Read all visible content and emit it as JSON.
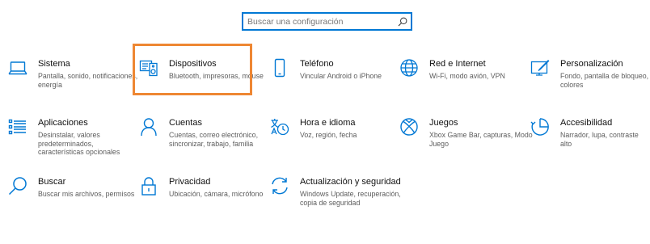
{
  "search": {
    "placeholder": "Buscar una configuración",
    "icon": "search-icon"
  },
  "accent_color": "#0078d4",
  "highlight_color": "#ee8733",
  "categories": [
    {
      "title": "Sistema",
      "desc": [
        "Pantalla, sonido, notificaciones,",
        "energía"
      ],
      "icon": "laptop-icon"
    },
    {
      "title": "Dispositivos",
      "desc": [
        "Bluetooth, impresoras, mouse"
      ],
      "icon": "devices-icon",
      "highlighted": true
    },
    {
      "title": "Teléfono",
      "desc": [
        "Vincular Android o iPhone"
      ],
      "icon": "phone-icon"
    },
    {
      "title": "Red e Internet",
      "desc": [
        "Wi-Fi, modo avión, VPN"
      ],
      "icon": "globe-icon"
    },
    {
      "title": "Personalización",
      "desc": [
        "Fondo, pantalla de bloqueo,",
        "colores"
      ],
      "icon": "personalization-icon"
    },
    {
      "title": "Aplicaciones",
      "desc": [
        "Desinstalar, valores",
        "predeterminados,",
        "características opcionales"
      ],
      "icon": "apps-list-icon"
    },
    {
      "title": "Cuentas",
      "desc": [
        "Cuentas, correo electrónico,",
        "sincronizar, trabajo, familia"
      ],
      "icon": "person-icon"
    },
    {
      "title": "Hora e idioma",
      "desc": [
        "Voz, región, fecha"
      ],
      "icon": "time-language-icon"
    },
    {
      "title": "Juegos",
      "desc": [
        "Xbox Game Bar, capturas, Modo",
        "Juego"
      ],
      "icon": "xbox-icon"
    },
    {
      "title": "Accesibilidad",
      "desc": [
        "Narrador, lupa, contraste alto"
      ],
      "icon": "accessibility-icon"
    },
    {
      "title": "Buscar",
      "desc": [
        "Buscar mis archivos, permisos"
      ],
      "icon": "search-icon"
    },
    {
      "title": "Privacidad",
      "desc": [
        "Ubicación, cámara, micrófono"
      ],
      "icon": "lock-icon"
    },
    {
      "title": "Actualización y seguridad",
      "desc": [
        "Windows Update, recuperación,",
        "copia de seguridad"
      ],
      "icon": "update-icon"
    }
  ]
}
